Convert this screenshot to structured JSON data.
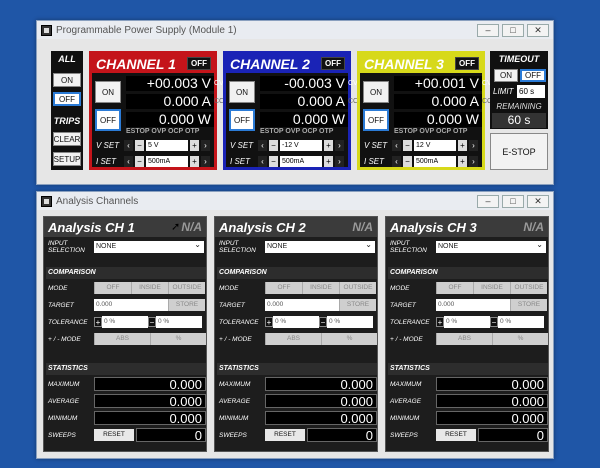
{
  "module_window": {
    "title": "Programmable Power Supply (Module 1)",
    "all": {
      "header": "ALL",
      "on": "ON",
      "off": "OFF"
    },
    "trips": {
      "header": "TRIPS",
      "clear": "CLEAR",
      "setup": "SETUP"
    },
    "channels": [
      {
        "name": "CHANNEL 1",
        "state": "OFF",
        "color": "#c4141a",
        "on": "ON",
        "off": "OFF",
        "voltage": "+00.003 V",
        "current": "0.000 A",
        "power": "0.000 W",
        "v_unit": "CV",
        "c_unit": "CC",
        "flags": "ESTOP OVP OCP OTP",
        "vset_label": "V SET",
        "vset": "5 V",
        "iset_label": "I SET",
        "iset": "500mA"
      },
      {
        "name": "CHANNEL 2",
        "state": "OFF",
        "color": "#1a23b6",
        "on": "ON",
        "off": "OFF",
        "voltage": "-00.003 V",
        "current": "0.000 A",
        "power": "0.000 W",
        "v_unit": "CV",
        "c_unit": "CC",
        "flags": "ESTOP OVP OCP OTP",
        "vset_label": "V SET",
        "vset": "-12 V",
        "iset_label": "I SET",
        "iset": "500mA"
      },
      {
        "name": "CHANNEL 3",
        "state": "OFF",
        "color": "#d7d91a",
        "on": "ON",
        "off": "OFF",
        "voltage": "+00.001 V",
        "current": "0.000 A",
        "power": "0.000 W",
        "v_unit": "CV",
        "c_unit": "CC",
        "flags": "ESTOP OVP OCP OTP",
        "vset_label": "V SET",
        "vset": "12 V",
        "iset_label": "I SET",
        "iset": "500mA"
      }
    ],
    "timeout": {
      "header": "TIMEOUT",
      "on": "ON",
      "off": "OFF",
      "limit_label": "LIMIT",
      "limit": "60 s",
      "remaining_label": "REMAINING",
      "remaining": "60 s"
    },
    "estop": "E-STOP"
  },
  "analysis_window": {
    "title": "Analysis Channels",
    "channels": [
      {
        "name": "Analysis CH 1",
        "na": "N/A",
        "input_label": "INPUT SELECTION",
        "input": "NONE",
        "comparison": "COMPARISON",
        "mode_label": "MODE",
        "modes": [
          "OFF",
          "INSIDE",
          "OUTSIDE"
        ],
        "target_label": "TARGET",
        "target": "0.000",
        "store": "STORE",
        "tol_label": "TOLERANCE",
        "tol_a": "0 %",
        "tol_b": "0 %",
        "pm_label": "+ / - MODE",
        "abs": "ABS",
        "pct": "%",
        "statistics": "STATISTICS",
        "max_label": "MAXIMUM",
        "max": "0.000",
        "avg_label": "AVERAGE",
        "avg": "0.000",
        "min_label": "MINIMUM",
        "min": "0.000",
        "sweeps_label": "SWEEPS",
        "reset": "RESET",
        "sweeps": "0"
      },
      {
        "name": "Analysis CH 2",
        "na": "N/A",
        "input_label": "INPUT SELECTION",
        "input": "NONE",
        "comparison": "COMPARISON",
        "mode_label": "MODE",
        "modes": [
          "OFF",
          "INSIDE",
          "OUTSIDE"
        ],
        "target_label": "TARGET",
        "target": "0.000",
        "store": "STORE",
        "tol_label": "TOLERANCE",
        "tol_a": "0 %",
        "tol_b": "0 %",
        "pm_label": "+ / - MODE",
        "abs": "ABS",
        "pct": "%",
        "statistics": "STATISTICS",
        "max_label": "MAXIMUM",
        "max": "0.000",
        "avg_label": "AVERAGE",
        "avg": "0.000",
        "min_label": "MINIMUM",
        "min": "0.000",
        "sweeps_label": "SWEEPS",
        "reset": "RESET",
        "sweeps": "0"
      },
      {
        "name": "Analysis CH 3",
        "na": "N/A",
        "input_label": "INPUT SELECTION",
        "input": "NONE",
        "comparison": "COMPARISON",
        "mode_label": "MODE",
        "modes": [
          "OFF",
          "INSIDE",
          "OUTSIDE"
        ],
        "target_label": "TARGET",
        "target": "0.000",
        "store": "STORE",
        "tol_label": "TOLERANCE",
        "tol_a": "0 %",
        "tol_b": "0 %",
        "pm_label": "+ / - MODE",
        "abs": "ABS",
        "pct": "%",
        "statistics": "STATISTICS",
        "max_label": "MAXIMUM",
        "max": "0.000",
        "avg_label": "AVERAGE",
        "avg": "0.000",
        "min_label": "MINIMUM",
        "min": "0.000",
        "sweeps_label": "SWEEPS",
        "reset": "RESET",
        "sweeps": "0"
      }
    ]
  },
  "window_buttons": {
    "minimize": "–",
    "maximize": "□",
    "close": "✕"
  }
}
